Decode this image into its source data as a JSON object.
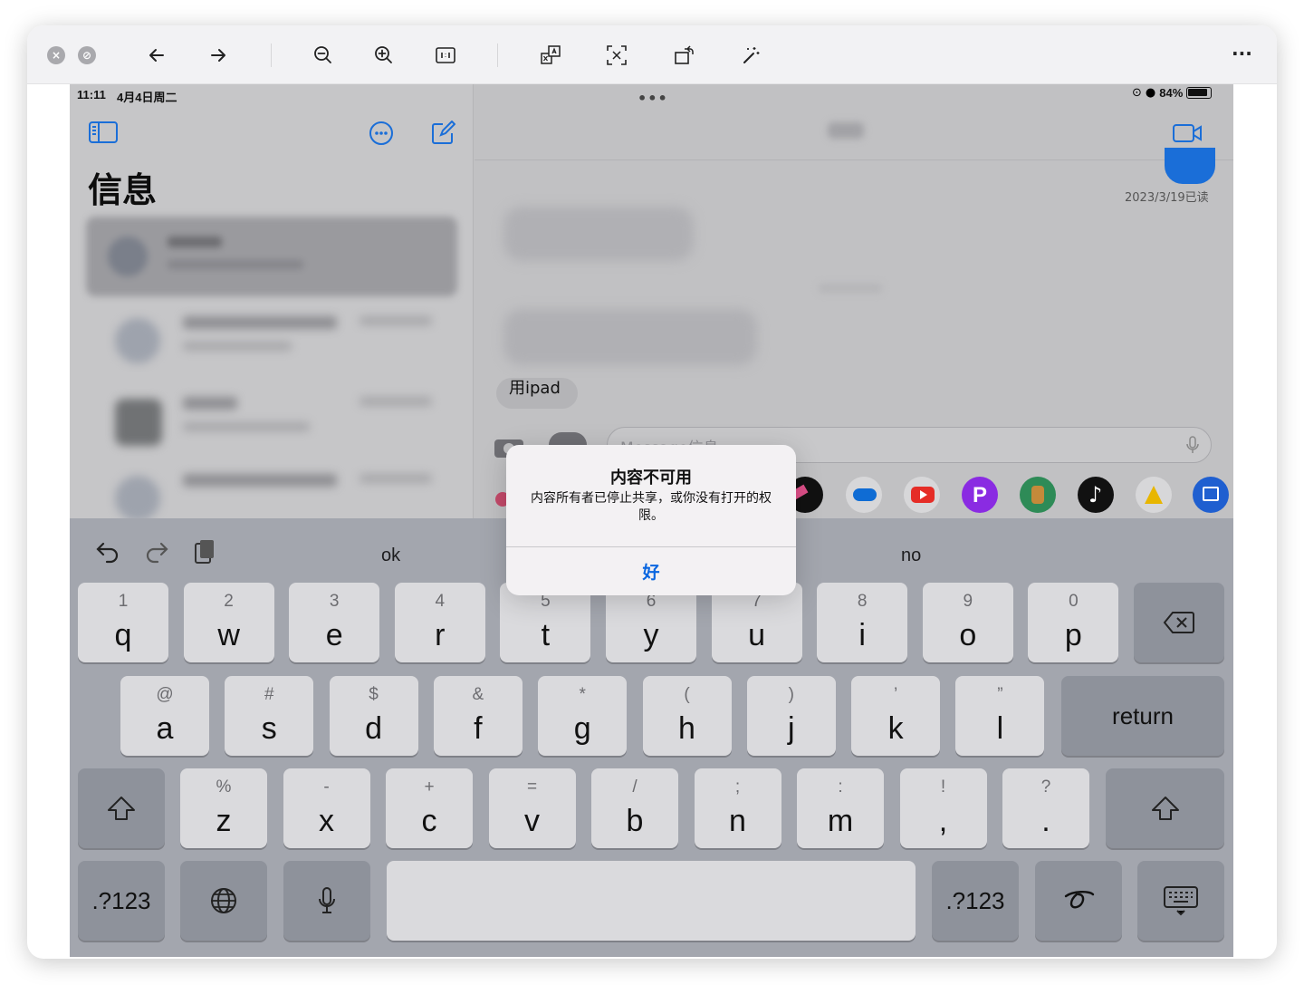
{
  "viewer": {
    "close": "×",
    "block": "⊘",
    "more": "···"
  },
  "status": {
    "time": "11:11",
    "date": "4月4日周二",
    "battery": "84%"
  },
  "sidebar": {
    "title": "信息"
  },
  "conversation": {
    "read_receipt": "2023/3/19已读",
    "partial_bubble": "用ipad",
    "input_placeholder": "Message信息"
  },
  "alert": {
    "title": "内容不可用",
    "message": "内容所有者已停止共享，或你没有打开的权限。",
    "button": "好"
  },
  "keyboard": {
    "suggestions": [
      "ok",
      "no"
    ],
    "row1": [
      {
        "hint": "1",
        "key": "q"
      },
      {
        "hint": "2",
        "key": "w"
      },
      {
        "hint": "3",
        "key": "e"
      },
      {
        "hint": "4",
        "key": "r"
      },
      {
        "hint": "5",
        "key": "t"
      },
      {
        "hint": "6",
        "key": "y"
      },
      {
        "hint": "7",
        "key": "u"
      },
      {
        "hint": "8",
        "key": "i"
      },
      {
        "hint": "9",
        "key": "o"
      },
      {
        "hint": "0",
        "key": "p"
      }
    ],
    "row2": [
      {
        "hint": "@",
        "key": "a"
      },
      {
        "hint": "#",
        "key": "s"
      },
      {
        "hint": "$",
        "key": "d"
      },
      {
        "hint": "&",
        "key": "f"
      },
      {
        "hint": "*",
        "key": "g"
      },
      {
        "hint": "(",
        "key": "h"
      },
      {
        "hint": ")",
        "key": "j"
      },
      {
        "hint": "’",
        "key": "k"
      },
      {
        "hint": "”",
        "key": "l"
      }
    ],
    "row3": [
      {
        "hint": "%",
        "key": "z"
      },
      {
        "hint": "-",
        "key": "x"
      },
      {
        "hint": "+",
        "key": "c"
      },
      {
        "hint": "=",
        "key": "v"
      },
      {
        "hint": "/",
        "key": "b"
      },
      {
        "hint": ";",
        "key": "n"
      },
      {
        "hint": ":",
        "key": "m"
      },
      {
        "hint": "!",
        "key": ","
      },
      {
        "hint": "?",
        "key": "."
      }
    ],
    "return_label": "return",
    "numbers_label": ".?123"
  },
  "icons": {
    "toolbar": [
      "back-arrow-icon",
      "forward-arrow-icon",
      "zoom-out-icon",
      "zoom-in-icon",
      "actual-size-icon",
      "translate-icon",
      "text-recognition-icon",
      "rotate-icon",
      "magic-wand-icon"
    ],
    "apps": [
      "photos",
      "pencil",
      "onedrive",
      "youtube",
      "picsart",
      "game",
      "tiktok",
      "app-a",
      "preview"
    ]
  },
  "colors": {
    "accent": "#0a66e0",
    "keyboard_bg": "#a3a6ae",
    "key_light": "#dadadd",
    "key_dark": "#8e929b",
    "youtube": "#e52d27",
    "picsart": "#8a2be2",
    "tiktok": "#111111",
    "onedrive": "#0f6cd4"
  }
}
